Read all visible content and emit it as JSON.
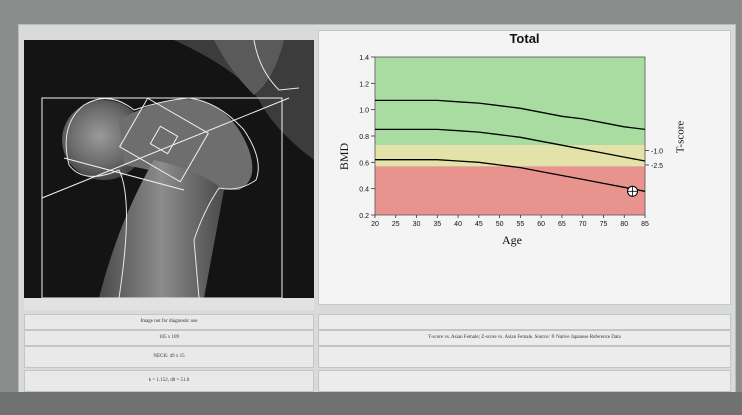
{
  "chart": {
    "title": "Total",
    "xlabel": "Age",
    "ylabel": "BMD",
    "tscore_label": "T-score",
    "tscore_ticks": [
      "-1.0",
      "-2.5"
    ],
    "x_ticks": [
      "20",
      "25",
      "30",
      "35",
      "40",
      "45",
      "50",
      "55",
      "60",
      "65",
      "70",
      "75",
      "80",
      "85"
    ],
    "y_ticks": [
      "0.2",
      "0.4",
      "0.6",
      "0.8",
      "1.0",
      "1.2",
      "1.4"
    ]
  },
  "chart_data": {
    "type": "line",
    "title": "Total",
    "xlabel": "Age",
    "ylabel": "BMD",
    "xlim": [
      20,
      85
    ],
    "ylim": [
      0.2,
      1.4
    ],
    "zones": [
      {
        "name": "normal",
        "from": 0.73,
        "to": 1.4,
        "color": "#a8dca0"
      },
      {
        "name": "osteopenia",
        "from": 0.57,
        "to": 0.73,
        "color": "#e3e2a8"
      },
      {
        "name": "osteoporosis",
        "from": 0.2,
        "to": 0.57,
        "color": "#e8938d"
      }
    ],
    "x": [
      20,
      25,
      30,
      35,
      40,
      45,
      50,
      55,
      60,
      65,
      70,
      75,
      80,
      85
    ],
    "series": [
      {
        "values": [
          1.07,
          1.07,
          1.07,
          1.07,
          1.06,
          1.05,
          1.03,
          1.01,
          0.98,
          0.95,
          0.93,
          0.9,
          0.87,
          0.85
        ]
      },
      {
        "values": [
          0.85,
          0.85,
          0.85,
          0.85,
          0.84,
          0.83,
          0.81,
          0.79,
          0.76,
          0.73,
          0.7,
          0.67,
          0.64,
          0.61
        ]
      },
      {
        "values": [
          0.62,
          0.62,
          0.62,
          0.62,
          0.61,
          0.6,
          0.58,
          0.56,
          0.53,
          0.5,
          0.47,
          0.44,
          0.41,
          0.38
        ]
      }
    ],
    "patient_point": {
      "x": 82,
      "y": 0.38
    },
    "tscore_ticks": [
      {
        "label": "-1.0",
        "y": 0.69
      },
      {
        "label": "-2.5",
        "y": 0.58
      }
    ]
  },
  "info": {
    "row1": "Image not for diagnostic use",
    "row2": "105 x 109",
    "row3": "NECK: 49 x 15",
    "row4": "k = 1.152, d0 = 51.0",
    "right_row2": "T-score vs. Asian Female; Z-score vs. Asian Female. Source: ® Native Japanese Reference Data"
  }
}
